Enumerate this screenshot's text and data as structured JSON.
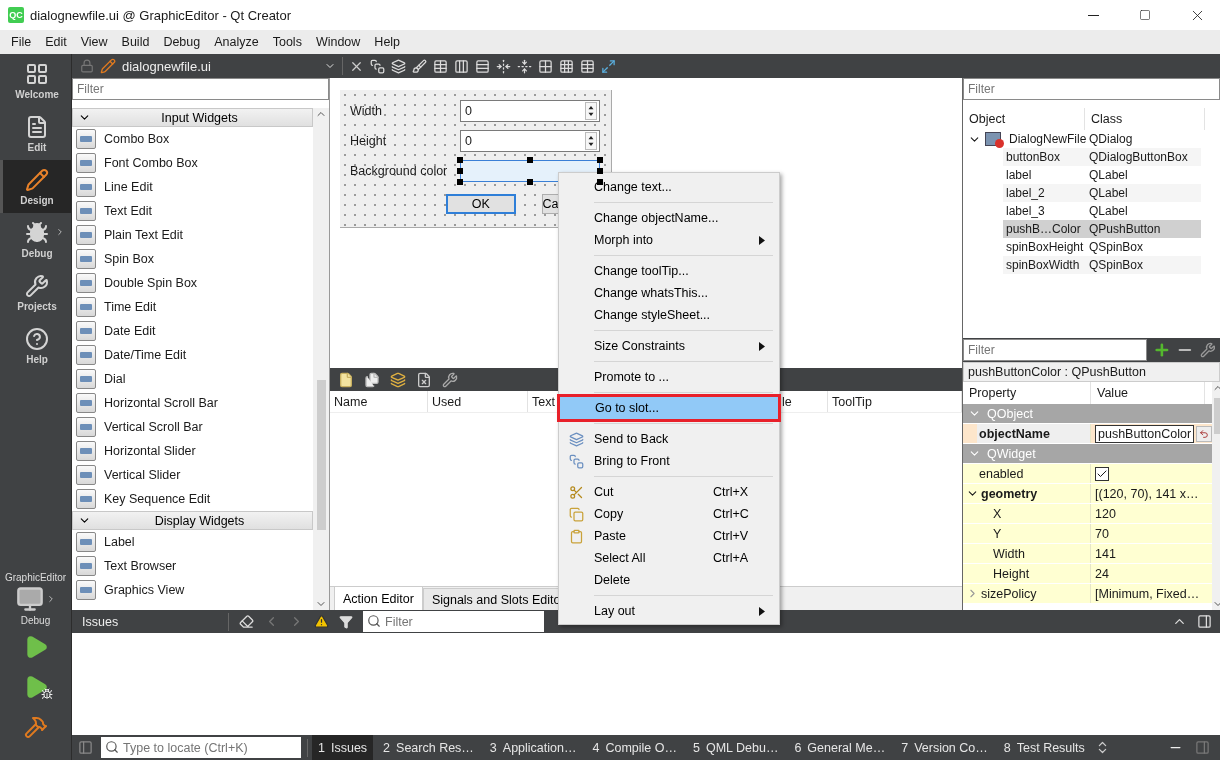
{
  "window": {
    "title": "dialognewfile.ui @ GraphicEditor - Qt Creator",
    "badge": "QC"
  },
  "menu": [
    "File",
    "Edit",
    "View",
    "Build",
    "Debug",
    "Analyze",
    "Tools",
    "Window",
    "Help"
  ],
  "modes": [
    {
      "label": "Welcome",
      "selected": false,
      "submenu": false
    },
    {
      "label": "Edit",
      "selected": false,
      "submenu": false
    },
    {
      "label": "Design",
      "selected": true,
      "submenu": false
    },
    {
      "label": "Debug",
      "selected": false,
      "submenu": true
    },
    {
      "label": "Projects",
      "selected": false,
      "submenu": false
    },
    {
      "label": "Help",
      "selected": false,
      "submenu": false
    }
  ],
  "target": {
    "project": "GraphicEditor",
    "config": "Debug"
  },
  "editor_toolbar": {
    "file": "dialognewfile.ui"
  },
  "widget_box": {
    "filter_placeholder": "Filter",
    "categories": [
      {
        "name": "Input Widgets",
        "expanded": true,
        "items": [
          "Combo Box",
          "Font Combo Box",
          "Line Edit",
          "Text Edit",
          "Plain Text Edit",
          "Spin Box",
          "Double Spin Box",
          "Time Edit",
          "Date Edit",
          "Date/Time Edit",
          "Dial",
          "Horizontal Scroll Bar",
          "Vertical Scroll Bar",
          "Horizontal Slider",
          "Vertical Slider",
          "Key Sequence Edit"
        ]
      },
      {
        "name": "Display Widgets",
        "expanded": true,
        "items": [
          "Label",
          "Text Browser",
          "Graphics View"
        ]
      }
    ]
  },
  "form": {
    "rows": [
      {
        "label": "Width",
        "kind": "spin",
        "value": "0"
      },
      {
        "label": "Height",
        "kind": "spin",
        "value": "0"
      },
      {
        "label": "Background color",
        "kind": "button",
        "selected": true
      }
    ],
    "buttons": [
      {
        "label": "OK",
        "default": true
      },
      {
        "label": "Ca",
        "default": false
      }
    ]
  },
  "action_editor": {
    "columns": [
      "Name",
      "Used",
      "Text",
      "le",
      "ToolTip"
    ],
    "tabs": [
      {
        "label": "Action Editor",
        "selected": true
      },
      {
        "label": "Signals and Slots Edito",
        "selected": false
      }
    ]
  },
  "context_menu": {
    "sections": [
      [
        {
          "label": "Change text...",
          "selected": false,
          "submenu": false
        }
      ],
      [
        {
          "label": "Change objectName...",
          "selected": false,
          "submenu": false
        },
        {
          "label": "Morph into",
          "selected": false,
          "submenu": true
        }
      ],
      [
        {
          "label": "Change toolTip...",
          "selected": false,
          "submenu": false
        },
        {
          "label": "Change whatsThis...",
          "selected": false,
          "submenu": false
        },
        {
          "label": "Change styleSheet...",
          "selected": false,
          "submenu": false
        }
      ],
      [
        {
          "label": "Size Constraints",
          "selected": false,
          "submenu": true
        }
      ],
      [
        {
          "label": "Promote to ...",
          "selected": false,
          "submenu": false
        }
      ],
      [
        {
          "label": "Go to slot...",
          "selected": true,
          "submenu": false
        }
      ],
      [
        {
          "label": "Send to Back",
          "selected": false,
          "submenu": false
        },
        {
          "label": "Bring to Front",
          "selected": false,
          "submenu": false
        }
      ],
      [
        {
          "label": "Cut",
          "shortcut": "Ctrl+X",
          "selected": false,
          "submenu": false
        },
        {
          "label": "Copy",
          "shortcut": "Ctrl+C",
          "selected": false,
          "submenu": false
        },
        {
          "label": "Paste",
          "shortcut": "Ctrl+V",
          "selected": false,
          "submenu": false
        },
        {
          "label": "Select All",
          "shortcut": "Ctrl+A",
          "selected": false,
          "submenu": false
        },
        {
          "label": "Delete",
          "selected": false,
          "submenu": false
        }
      ],
      [
        {
          "label": "Lay out",
          "selected": false,
          "submenu": true
        }
      ]
    ]
  },
  "object_inspector": {
    "filter_placeholder": "Filter",
    "columns": [
      "Object",
      "Class"
    ],
    "root": {
      "name": "DialogNewFile",
      "class": "QDialog",
      "expanded": true,
      "children": [
        {
          "name": "buttonBox",
          "class": "QDialogButtonBox",
          "selected": false
        },
        {
          "name": "label",
          "class": "QLabel",
          "selected": false
        },
        {
          "name": "label_2",
          "class": "QLabel",
          "selected": false
        },
        {
          "name": "label_3",
          "class": "QLabel",
          "selected": false
        },
        {
          "name": "pushB…Color",
          "class": "QPushButton",
          "selected": true
        },
        {
          "name": "spinBoxHeight",
          "class": "QSpinBox",
          "selected": false
        },
        {
          "name": "spinBoxWidth",
          "class": "QSpinBox",
          "selected": false
        }
      ]
    }
  },
  "property_editor": {
    "filter_placeholder": "Filter",
    "title": "pushButtonColor : QPushButton",
    "columns": [
      "Property",
      "Value"
    ],
    "rows": [
      {
        "kind": "group",
        "name": "QObject",
        "color": "#fde6cb",
        "expanded": true,
        "children": [
          {
            "kind": "text",
            "name": "objectName",
            "value": "pushButtonColor",
            "modified": true,
            "editing": true
          }
        ]
      },
      {
        "kind": "group",
        "name": "QWidget",
        "color": "#ffffd2",
        "expanded": true,
        "children": [
          {
            "kind": "check",
            "name": "enabled",
            "checked": true,
            "modified": false
          },
          {
            "kind": "text",
            "name": "geometry",
            "value": "[(120, 70), 141 x…",
            "modified": true,
            "expanded": true,
            "children": [
              {
                "kind": "text",
                "name": "X",
                "value": "120",
                "modified": false
              },
              {
                "kind": "text",
                "name": "Y",
                "value": "70",
                "modified": false
              },
              {
                "kind": "text",
                "name": "Width",
                "value": "141",
                "modified": false
              },
              {
                "kind": "text",
                "name": "Height",
                "value": "24",
                "modified": false
              }
            ]
          },
          {
            "kind": "text",
            "name": "sizePolicy",
            "value": "[Minimum, Fixed…",
            "modified": false,
            "expanded": false
          }
        ]
      }
    ]
  },
  "issues": {
    "title": "Issues",
    "filter_placeholder": "Filter"
  },
  "status_bar": {
    "locate_placeholder": "Type to locate (Ctrl+K)",
    "panes": [
      {
        "number": "1",
        "label": "Issues",
        "selected": true
      },
      {
        "number": "2",
        "label": "Search Res…",
        "selected": false
      },
      {
        "number": "3",
        "label": "Application…",
        "selected": false
      },
      {
        "number": "4",
        "label": "Compile O…",
        "selected": false
      },
      {
        "number": "5",
        "label": "QML Debu…",
        "selected": false
      },
      {
        "number": "6",
        "label": "General Me…",
        "selected": false
      },
      {
        "number": "7",
        "label": "Version Co…",
        "selected": false
      },
      {
        "number": "8",
        "label": "Test Results",
        "selected": false
      }
    ]
  }
}
